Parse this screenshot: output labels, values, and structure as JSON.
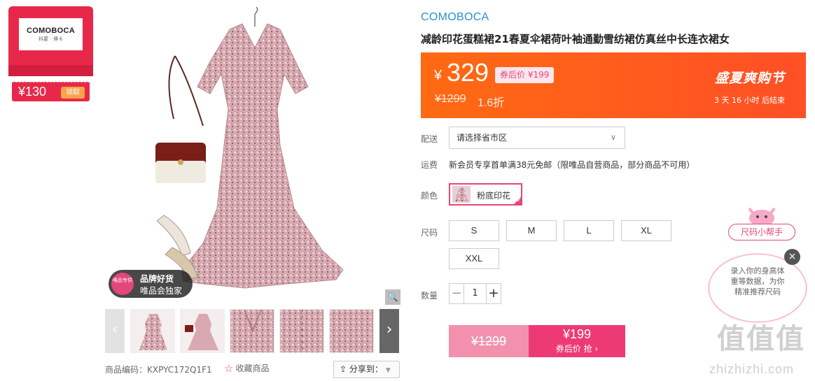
{
  "coupon": {
    "brand": "COMOBOCA",
    "brand_sub": "科蒙 · 博卡",
    "amount": "¥130",
    "claim": "领取"
  },
  "badge": {
    "circle_text": "唯品专供",
    "line1": "品牌好货",
    "line2": "唯品会独家"
  },
  "product": {
    "brand": "COMOBOCA",
    "title": "减龄印花蛋糕裙21春夏伞裙荷叶袖通勤雪纺裙仿真丝中长连衣裙女",
    "code_label": "商品编码：KXPYC172Q1F1",
    "favorite": "收藏商品",
    "share": "分享到："
  },
  "price": {
    "yen": "¥",
    "current": "329",
    "after_coupon": "券后价 ¥199",
    "original": "¥1299",
    "discount": "1.6折",
    "festival": "盛夏爽购节",
    "countdown": "3 天 16 小时 后结束"
  },
  "delivery": {
    "label": "配送",
    "select_value": "请选择省市区"
  },
  "shipping": {
    "label": "运费",
    "text": "新会员专享首单满38元免邮（限唯品自营商品，部分商品不可用）"
  },
  "color": {
    "label": "颜色",
    "option": "粉底印花"
  },
  "size": {
    "label": "尺码",
    "options": [
      "S",
      "M",
      "L",
      "XL",
      "XXL"
    ]
  },
  "quantity": {
    "label": "数量",
    "value": "1",
    "minus": "−",
    "plus": "+"
  },
  "buy": {
    "original": "¥1299",
    "price": "¥199",
    "cta": "券后价 抢 ›"
  },
  "size_helper": {
    "pill": "尺码小帮手",
    "bubble_line1": "录入你的身高体",
    "bubble_line2": "重等数据，为你",
    "bubble_line3": "精准推荐尺码",
    "close": "×"
  },
  "watermark": {
    "text": "值值值",
    "url": "zhizhizhi.com"
  },
  "icons": {
    "zoom": "search-icon",
    "prev": "chevron-left-icon",
    "next": "chevron-right-icon",
    "star": "star-outline-icon",
    "share": "share-icon"
  },
  "colors": {
    "accent_pink": "#e3477c",
    "price_orange": "#ff5a1e",
    "coupon_red": "#e8284a",
    "brand_blue": "#2990d7"
  }
}
